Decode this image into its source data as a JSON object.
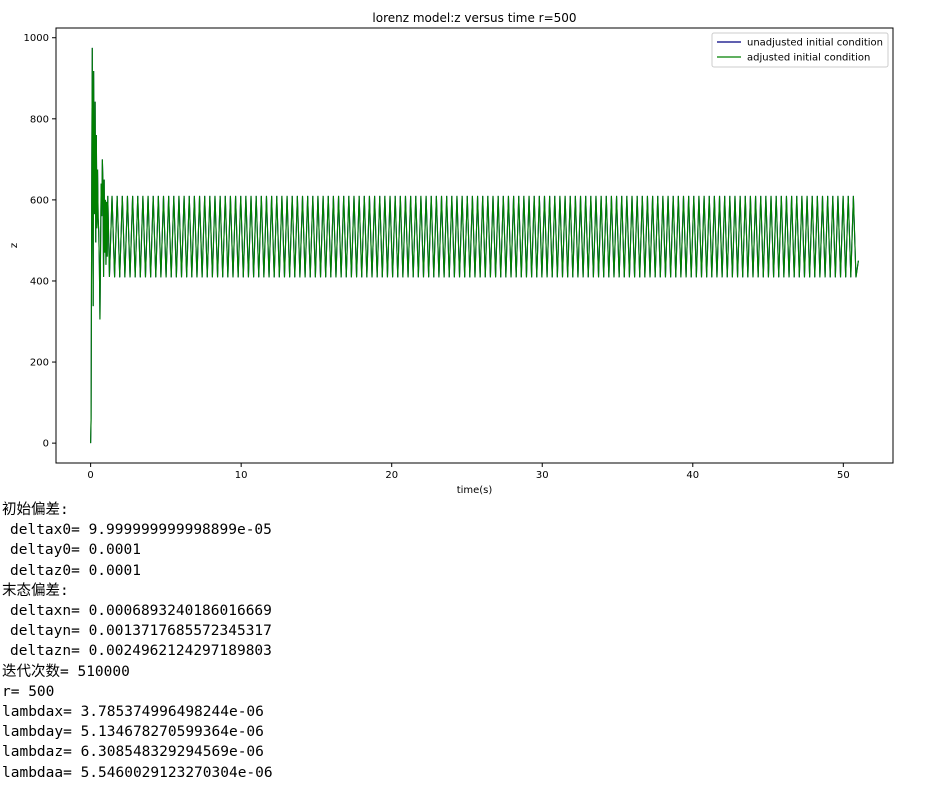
{
  "chart_data": {
    "type": "line",
    "title": "lorenz model:z versus time r=500",
    "xlabel": "time(s)",
    "ylabel": "z",
    "xlim": [
      -2.3,
      53.3
    ],
    "ylim": [
      -49,
      1024
    ],
    "xticks": [
      0,
      10,
      20,
      30,
      40,
      50
    ],
    "yticks": [
      0,
      200,
      400,
      600,
      800,
      1000
    ],
    "legend_position": "top-right",
    "grid": false,
    "t_start": 0,
    "t_end": 51,
    "steady_min": 409,
    "steady_max": 610,
    "oscillation_period": 0.342,
    "transient": [
      [
        0.0,
        0
      ],
      [
        0.03,
        60
      ],
      [
        0.08,
        700
      ],
      [
        0.11,
        975
      ],
      [
        0.14,
        560
      ],
      [
        0.17,
        338
      ],
      [
        0.2,
        918
      ],
      [
        0.24,
        605
      ],
      [
        0.27,
        565
      ],
      [
        0.3,
        842
      ],
      [
        0.34,
        495
      ],
      [
        0.38,
        760
      ],
      [
        0.42,
        530
      ],
      [
        0.46,
        675
      ],
      [
        0.5,
        555
      ],
      [
        0.54,
        520
      ],
      [
        0.58,
        440
      ],
      [
        0.62,
        305
      ],
      [
        0.66,
        480
      ],
      [
        0.7,
        640
      ],
      [
        0.74,
        560
      ],
      [
        0.78,
        700
      ],
      [
        0.82,
        640
      ],
      [
        0.86,
        410
      ],
      [
        0.9,
        650
      ],
      [
        0.94,
        470
      ],
      [
        0.98,
        600
      ],
      [
        1.02,
        440
      ],
      [
        1.06,
        595
      ],
      [
        1.1,
        460
      ],
      [
        1.14,
        610
      ],
      [
        1.25,
        410
      ]
    ],
    "series": [
      {
        "name": "unadjusted initial condition",
        "color": "#000080"
      },
      {
        "name": "adjusted initial condition",
        "color": "#008000"
      }
    ]
  },
  "output_lines": [
    {
      "text": "初始偏差:",
      "indent": false
    },
    {
      "text": "deltax0= 9.999999999998899e-05",
      "indent": true
    },
    {
      "text": "deltay0= 0.0001",
      "indent": true
    },
    {
      "text": "deltaz0= 0.0001",
      "indent": true
    },
    {
      "text": "末态偏差:",
      "indent": false
    },
    {
      "text": "deltaxn= 0.0006893240186016669",
      "indent": true
    },
    {
      "text": "deltayn= 0.001371768557234531​7",
      "indent": true
    },
    {
      "text": "deltazn= 0.0024962124297189803",
      "indent": true
    },
    {
      "text": "迭代次数= 510000",
      "indent": false
    },
    {
      "text": "r= 500",
      "indent": false
    },
    {
      "text": "lambdax= 3.785374996498244e-06",
      "indent": false
    },
    {
      "text": "lambday= 5.134678270599364e-06",
      "indent": false
    },
    {
      "text": "lambdaz= 6.308548329294569e-06",
      "indent": false
    },
    {
      "text": "lambdaa= 5.5460029123270304e-06",
      "indent": false
    }
  ]
}
